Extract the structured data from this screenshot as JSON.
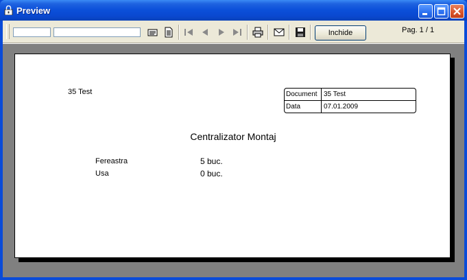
{
  "window": {
    "title": "Preview"
  },
  "toolbar": {
    "inchide_label": "Inchide",
    "page_indicator": "Pag. 1 / 1",
    "field1_value": "",
    "field2_value": ""
  },
  "report": {
    "header_left": "35 Test",
    "info": [
      {
        "label": "Document",
        "value": "35 Test"
      },
      {
        "label": "Data",
        "value": "07.01.2009"
      }
    ],
    "title": "Centralizator Montaj",
    "rows": [
      {
        "item": "Fereastra",
        "qty": "5 buc."
      },
      {
        "item": "Usa",
        "qty": "0 buc."
      }
    ]
  },
  "colors": {
    "titlebar": "#0a4bd8",
    "toolbar": "#ece9d8",
    "preview_bg": "#808080"
  }
}
